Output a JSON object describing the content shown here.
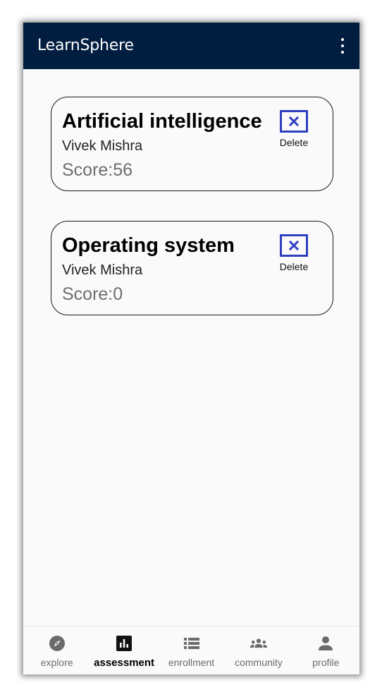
{
  "app_bar": {
    "title": "LearnSphere",
    "menu_icon": "more-vert-icon"
  },
  "assessments": [
    {
      "title": "Artificial intelligence",
      "author": "Vivek Mishra",
      "score": "Score:56",
      "delete_label": "Delete"
    },
    {
      "title": "Operating system",
      "author": "Vivek Mishra",
      "score": "Score:0",
      "delete_label": "Delete"
    }
  ],
  "bottom_nav": {
    "active": "assessment",
    "items": [
      {
        "label": "explore",
        "icon": "compass-icon"
      },
      {
        "label": "assessment",
        "icon": "bar-chart-icon"
      },
      {
        "label": "enrollment",
        "icon": "list-icon"
      },
      {
        "label": "community",
        "icon": "people-icon"
      },
      {
        "label": "profile",
        "icon": "person-icon"
      }
    ]
  },
  "colors": {
    "app_bar_bg": "#011e41",
    "delete_accent": "#2f3fc1",
    "score_text": "#6e6e6e"
  }
}
